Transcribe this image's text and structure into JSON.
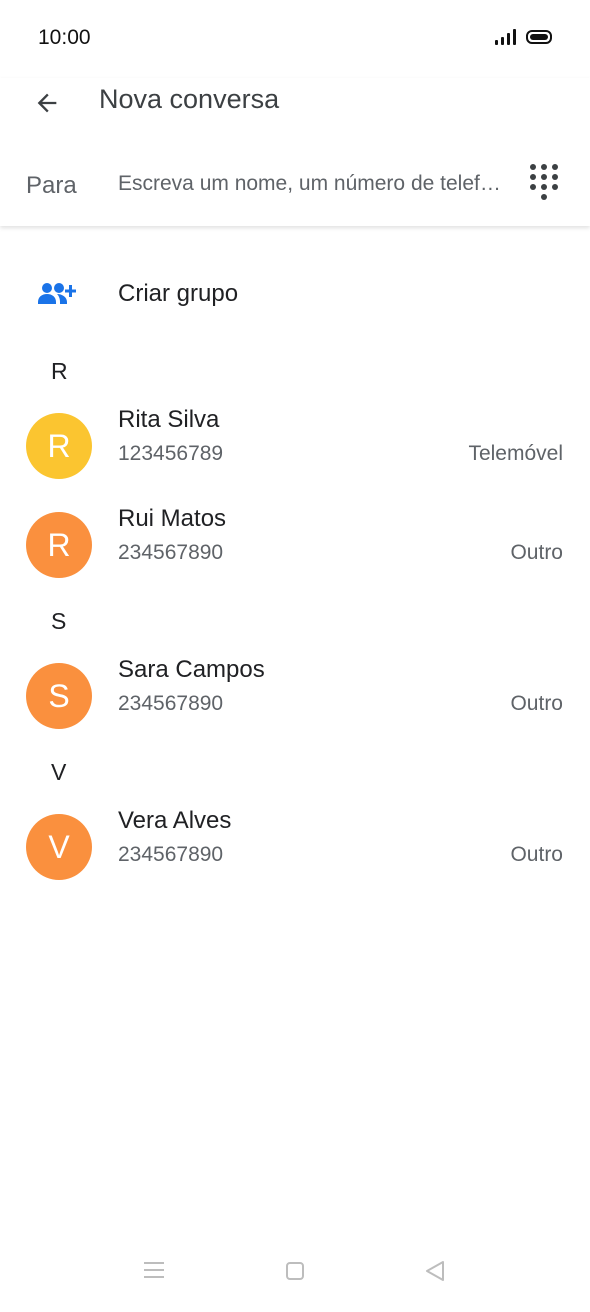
{
  "status_bar": {
    "time": "10:00"
  },
  "header": {
    "title": "Nova conversa",
    "to_label": "Para",
    "to_placeholder": "Escreva um nome, um número de telefone ou um e-mail"
  },
  "create_group": {
    "label": "Criar grupo"
  },
  "sections": [
    {
      "letter": "R",
      "contacts": [
        {
          "initial": "R",
          "name": "Rita Silva",
          "number": "123456789",
          "type": "Telemóvel",
          "color": "#fbc530"
        },
        {
          "initial": "R",
          "name": "Rui Matos",
          "number": "234567890",
          "type": "Outro",
          "color": "#fa903e"
        }
      ]
    },
    {
      "letter": "S",
      "contacts": [
        {
          "initial": "S",
          "name": "Sara Campos",
          "number": "234567890",
          "type": "Outro",
          "color": "#fa903e"
        }
      ]
    },
    {
      "letter": "V",
      "contacts": [
        {
          "initial": "V",
          "name": "Vera Alves",
          "number": "234567890",
          "type": "Outro",
          "color": "#fa903e"
        }
      ]
    }
  ],
  "colors": {
    "accent": "#1a73e8"
  }
}
